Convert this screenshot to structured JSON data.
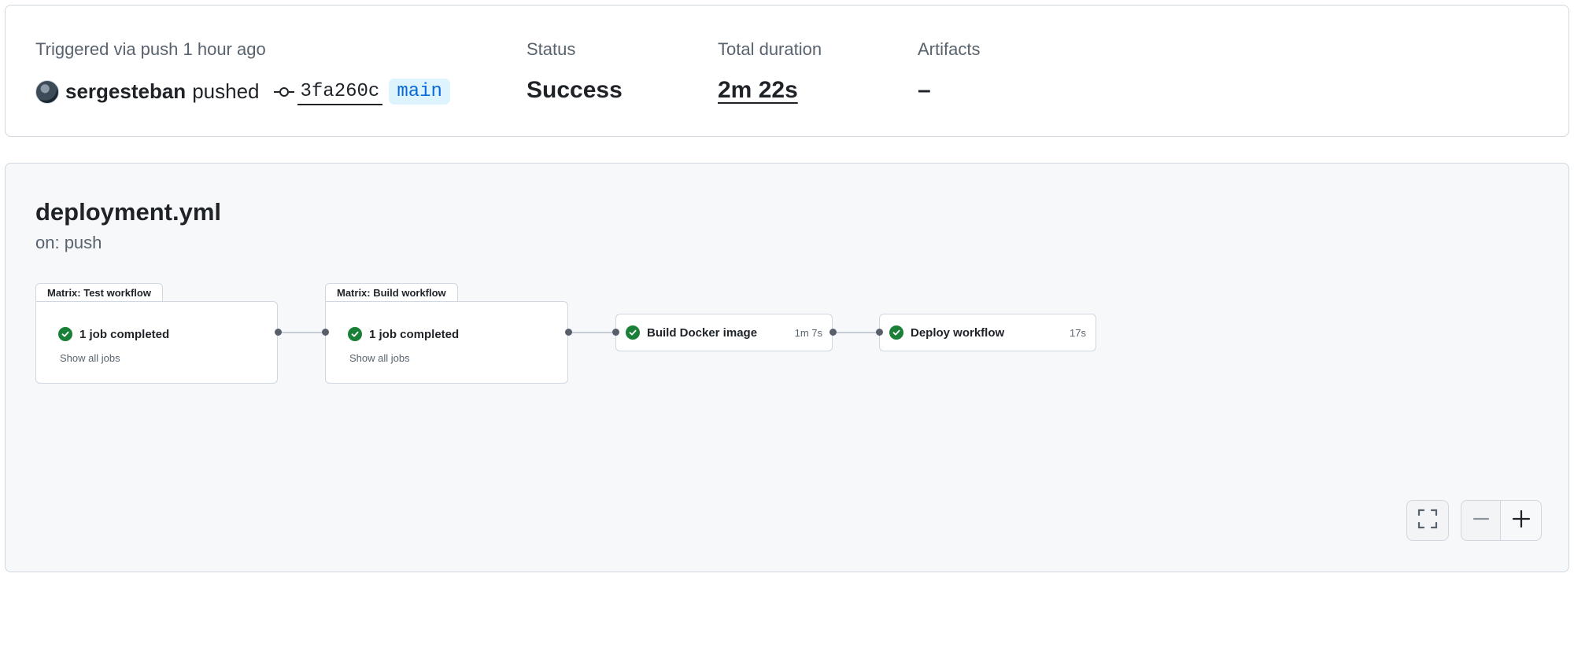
{
  "summary": {
    "trigger_label": "Triggered via push 1 hour ago",
    "actor": "sergesteban",
    "action": "pushed",
    "commit_sha": "3fa260c",
    "branch": "main",
    "status_label": "Status",
    "status_value": "Success",
    "duration_label": "Total duration",
    "duration_value": "2m 22s",
    "artifacts_label": "Artifacts",
    "artifacts_value": "–"
  },
  "workflow": {
    "file": "deployment.yml",
    "trigger": "on: push",
    "matrix_groups": [
      {
        "title": "Matrix: Test workflow",
        "status_text": "1 job completed",
        "show_all": "Show all jobs"
      },
      {
        "title": "Matrix: Build workflow",
        "status_text": "1 job completed",
        "show_all": "Show all jobs"
      }
    ],
    "jobs": [
      {
        "name": "Build Docker image",
        "duration": "1m 7s"
      },
      {
        "name": "Deploy workflow",
        "duration": "17s"
      }
    ]
  },
  "controls": {
    "fullscreen": "fullscreen-icon",
    "zoom_out": "minus-icon",
    "zoom_in": "plus-icon"
  },
  "colors": {
    "success": "#1a7f37",
    "branch_text": "#0969da",
    "branch_bg": "#ddf4ff",
    "panel_bg": "#f6f8fa"
  }
}
